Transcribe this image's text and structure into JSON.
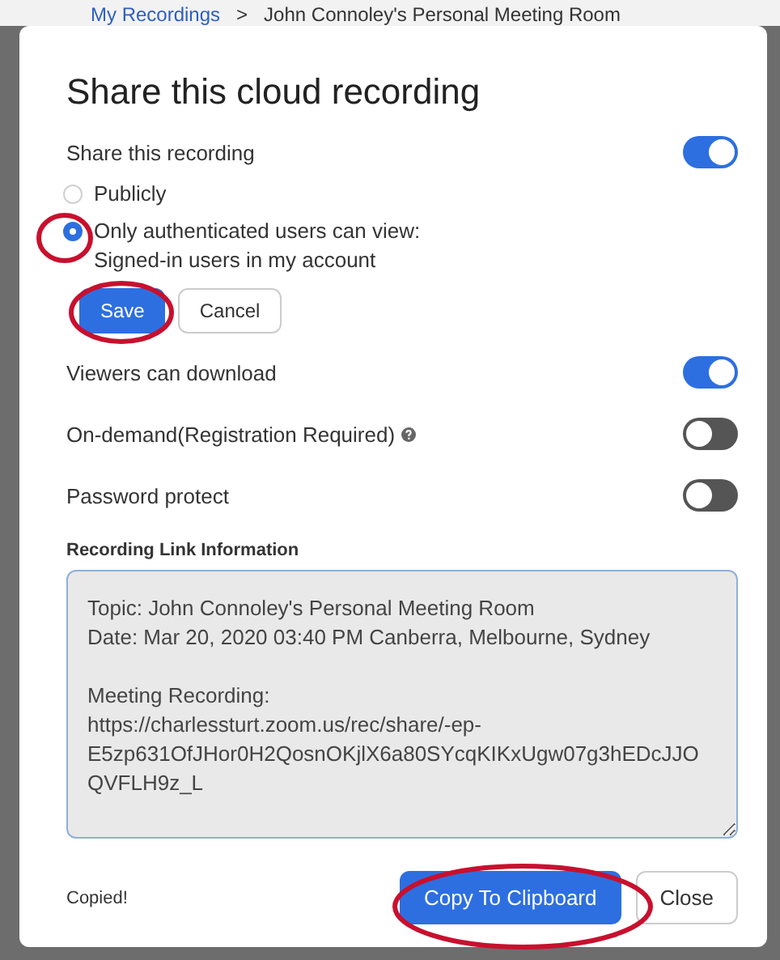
{
  "breadcrumb": {
    "link": "My Recordings",
    "separator": ">",
    "current": "John Connoley's Personal Meeting Room"
  },
  "dialog": {
    "title": "Share this cloud recording"
  },
  "share": {
    "label": "Share this recording",
    "on": true
  },
  "radios": [
    {
      "label": "Publicly",
      "selected": false
    },
    {
      "label": "Only authenticated users can view:",
      "sublabel": "Signed-in users in my account",
      "selected": true
    }
  ],
  "buttons": [
    {
      "label": "Save",
      "kind": "primary"
    },
    {
      "label": "Cancel",
      "kind": "secondary"
    }
  ],
  "options": [
    {
      "label": "Viewers can download",
      "on": true,
      "help": false
    },
    {
      "label": "On-demand(Registration Required)",
      "on": false,
      "help": true
    },
    {
      "label": "Password protect",
      "on": false,
      "help": false
    }
  ],
  "link_info": {
    "heading": "Recording Link Information",
    "value": "Topic: John Connoley's Personal Meeting Room\nDate: Mar 20, 2020 03:40 PM Canberra, Melbourne, Sydney\n\nMeeting Recording:\nhttps://charlessturt.zoom.us/rec/share/-ep-\nE5zp631OfJHor0H2QosnOKjlX6a80SYcqKIKxUgw07g3hEDcJJO\nQVFLH9z_L"
  },
  "footer": {
    "status": "Copied!",
    "buttons": [
      {
        "label": "Copy To Clipboard",
        "kind": "primary"
      },
      {
        "label": "Close",
        "kind": "secondary"
      }
    ]
  }
}
